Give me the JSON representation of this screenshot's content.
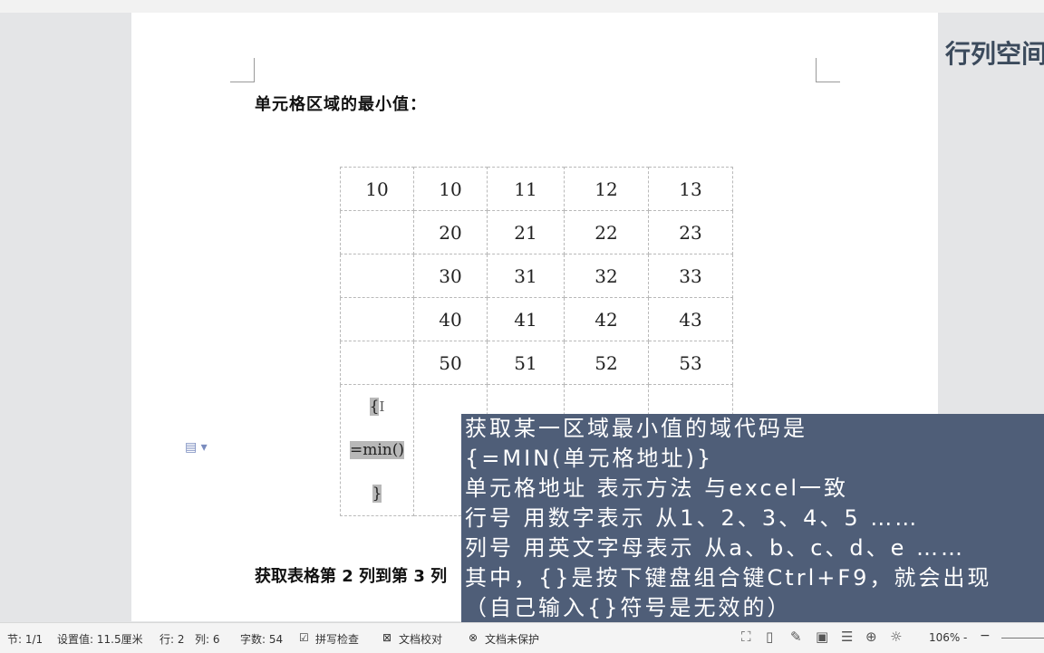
{
  "document": {
    "heading": "单元格区域的最小值：",
    "heading2": "获取表格第 2 列到第 3 列",
    "table": {
      "rows": [
        [
          "10",
          "10",
          "11",
          "12",
          "13"
        ],
        [
          "",
          "20",
          "21",
          "22",
          "23"
        ],
        [
          "",
          "30",
          "31",
          "32",
          "33"
        ],
        [
          "",
          "40",
          "41",
          "42",
          "43"
        ],
        [
          "",
          "50",
          "51",
          "52",
          "53"
        ]
      ],
      "formula_lines": [
        "{",
        "=min()",
        "}"
      ]
    }
  },
  "brand_text": "行列空间",
  "overlay_lines": [
    "获取某一区域最小值的域代码是",
    "{=MIN(单元格地址)}",
    "单元格地址 表示方法 与excel一致",
    "行号 用数字表示 从1、2、3、4、5 ……",
    "列号 用英文字母表示 从a、b、c、d、e ……",
    "其中，{}是按下键盘组合键Ctrl+F9，就会出现",
    "（自己输入{}符号是无效的）"
  ],
  "statusbar": {
    "section": "节: 1/1",
    "setting": "设置值: 11.5厘米",
    "row": "行: 2",
    "col": "列: 6",
    "word_count": "字数: 54",
    "spell_check": "拼写检查",
    "doc_proof": "文档校对",
    "doc_protect": "文档未保护",
    "zoom": "106%",
    "zoom_dropdown": "-",
    "zoom_minus": "−"
  },
  "colors": {
    "overlay_bg": "#4f5e78",
    "page_bg": "#ffffff",
    "workspace_bg": "#e4e5e7"
  }
}
